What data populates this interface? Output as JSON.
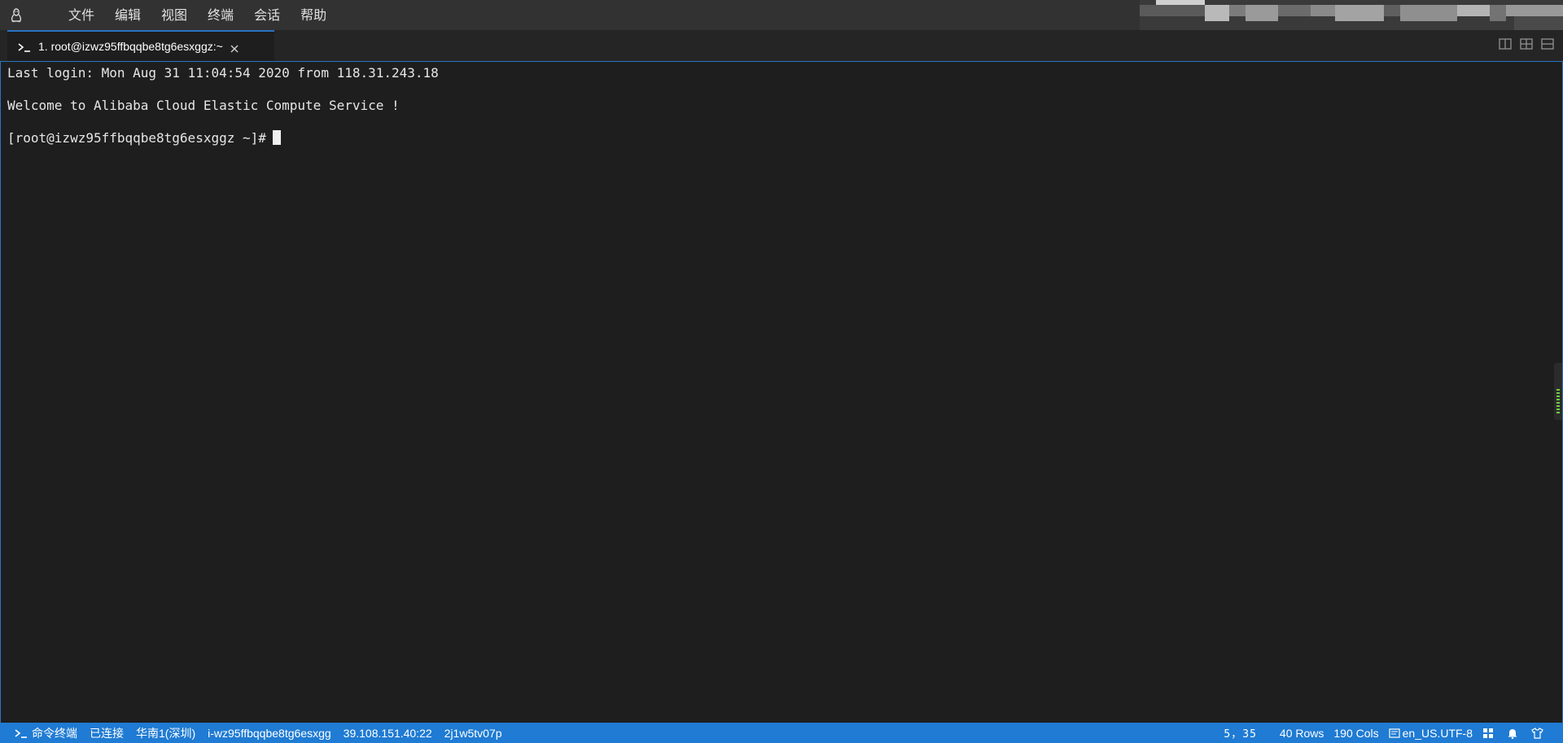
{
  "menubar": {
    "logo_icon": "linux-penguin-icon",
    "items": [
      "文件",
      "编辑",
      "视图",
      "终端",
      "会话",
      "帮助"
    ]
  },
  "tabs": [
    {
      "label": "1. root@izwz95ffbqqbe8tg6esxggz:~",
      "icon": "terminal-prompt-icon",
      "active": true
    }
  ],
  "terminal": {
    "lines": [
      "Last login: Mon Aug 31 11:04:54 2020 from 118.31.243.18",
      "Welcome to Alibaba Cloud Elastic Compute Service !",
      "[root@izwz95ffbqqbe8tg6esxggz ~]#"
    ]
  },
  "statusbar": {
    "mode": "命令终端",
    "connection": "已连接",
    "region": "华南1(深圳)",
    "instance_id": "i-wz95ffbqqbe8tg6esxgg",
    "address": "39.108.151.40:22",
    "session_id": "2j1w5tv07p",
    "cursor_pos": "5，35",
    "rows": "40 Rows",
    "cols": "190 Cols",
    "encoding": "en_US.UTF-8",
    "right_icons": [
      "layout-grid-icon",
      "bell-icon",
      "shirt-theme-icon"
    ]
  },
  "colors": {
    "accent": "#1f7bd3",
    "menubar_bg": "#323233",
    "terminal_bg": "#1e1e1e",
    "terminal_fg": "#e6e6e6"
  }
}
